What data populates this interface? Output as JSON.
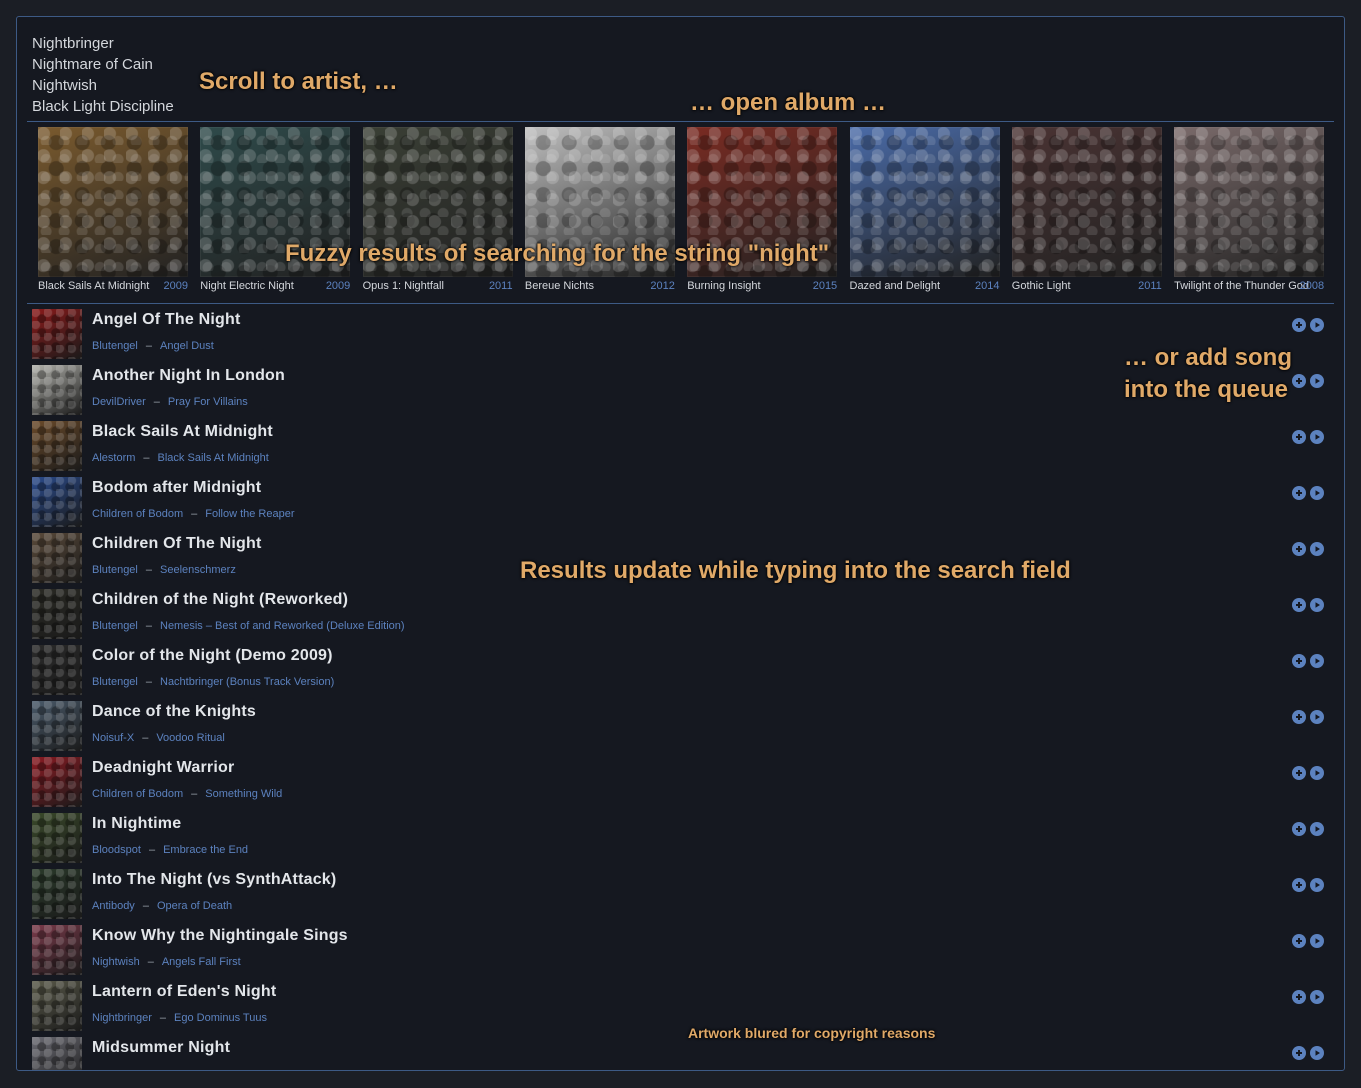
{
  "artists": [
    "Nightbringer",
    "Nightmare of Cain",
    "Nightwish",
    "Black Light Discipline"
  ],
  "albums": [
    {
      "title": "Black Sails At Midnight",
      "year": "2009",
      "color": "#7a5a2e"
    },
    {
      "title": "Night Electric Night",
      "year": "2009",
      "color": "#2e4a4a"
    },
    {
      "title": "Opus 1: Nightfall",
      "year": "2011",
      "color": "#3a3f35"
    },
    {
      "title": "Bereue Nichts",
      "year": "2012",
      "color": "#bfbfbf"
    },
    {
      "title": "Burning Insight",
      "year": "2015",
      "color": "#7a2b22"
    },
    {
      "title": "Dazed and Delight",
      "year": "2014",
      "color": "#4a6ba8"
    },
    {
      "title": "Gothic Light",
      "year": "2011",
      "color": "#4a3333"
    },
    {
      "title": "Twilight of the Thunder God",
      "year": "2008",
      "color": "#7a6a6a"
    }
  ],
  "songs": [
    {
      "title": "Angel Of The Night",
      "artist": "Blutengel",
      "album": "Angel Dust",
      "color": "#8a1a1a"
    },
    {
      "title": "Another Night In London",
      "artist": "DevilDriver",
      "album": "Pray For Villains",
      "color": "#b0b0aa"
    },
    {
      "title": "Black Sails At Midnight",
      "artist": "Alestorm",
      "album": "Black Sails At Midnight",
      "color": "#6a4a2a"
    },
    {
      "title": "Bodom after Midnight",
      "artist": "Children of Bodom",
      "album": "Follow the Reaper",
      "color": "#2a4a8a"
    },
    {
      "title": "Children Of The Night",
      "artist": "Blutengel",
      "album": "Seelenschmerz",
      "color": "#5a4a3a"
    },
    {
      "title": "Children of the Night (Reworked)",
      "artist": "Blutengel",
      "album": "Nemesis – Best of and Reworked (Deluxe Edition)",
      "color": "#2a2a24"
    },
    {
      "title": "Color of the Night (Demo 2009)",
      "artist": "Blutengel",
      "album": "Nachtbringer (Bonus Track Version)",
      "color": "#2a2a2a"
    },
    {
      "title": "Dance of the Knights",
      "artist": "Noisuf-X",
      "album": "Voodoo Ritual",
      "color": "#4a5a6a"
    },
    {
      "title": "Deadnight Warrior",
      "artist": "Children of Bodom",
      "album": "Something Wild",
      "color": "#8a1a22"
    },
    {
      "title": "In Nightime",
      "artist": "Bloodspot",
      "album": "Embrace the End",
      "color": "#3a4a2a"
    },
    {
      "title": "Into The Night (vs SynthAttack)",
      "artist": "Antibody",
      "album": "Opera of Death",
      "color": "#2a3a2a"
    },
    {
      "title": "Know Why the Nightingale Sings",
      "artist": "Nightwish",
      "album": "Angels Fall First",
      "color": "#7a3a4a"
    },
    {
      "title": "Lantern of Eden's Night",
      "artist": "Nightbringer",
      "album": "Ego Dominus Tuus",
      "color": "#5a5a4a"
    },
    {
      "title": "Midsummer Night",
      "artist": "",
      "album": "",
      "color": "#6a6a72"
    }
  ],
  "annotations": {
    "scroll_artist": "Scroll to artist, …",
    "open_album": "… open album …",
    "fuzzy": "Fuzzy results of searching for the string \"night\"",
    "add_song": "… or add song into the queue",
    "results_update": "Results update while typing into the search field",
    "blurred": "Artwork blured for copyright reasons"
  },
  "icons": {
    "add": "plus-circle-icon",
    "play": "play-circle-icon"
  },
  "accent": "#5c82bf"
}
